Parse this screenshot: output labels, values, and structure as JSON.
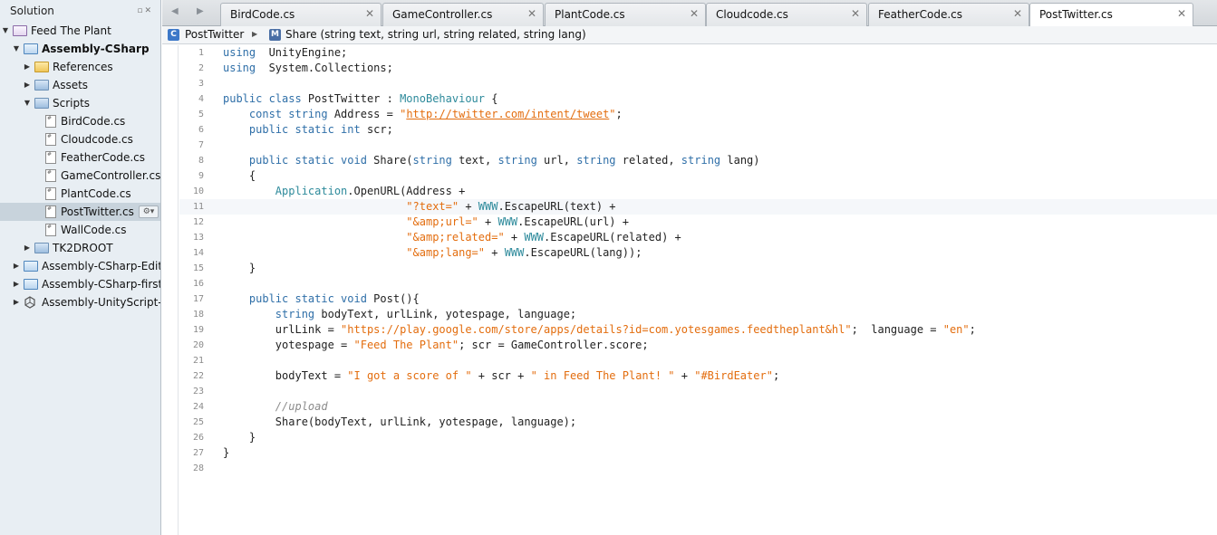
{
  "solution": {
    "title": "Solution",
    "header_buttons": "▫✕",
    "tree": [
      {
        "label": "Feed The Plant",
        "icon": "solution-icon",
        "depth": 0,
        "arrow": "▼",
        "bold": false
      },
      {
        "label": "Assembly-CSharp",
        "icon": "project-icon",
        "depth": 1,
        "arrow": "▼",
        "bold": true
      },
      {
        "label": "References",
        "icon": "folder-icon",
        "depth": 2,
        "arrow": "▶",
        "bold": false
      },
      {
        "label": "Assets",
        "icon": "folder-blue-icon",
        "depth": 2,
        "arrow": "▶",
        "bold": false
      },
      {
        "label": "Scripts",
        "icon": "folder-blue-icon",
        "depth": 2,
        "arrow": "▼",
        "bold": false
      },
      {
        "label": "BirdCode.cs",
        "icon": "file-icon",
        "depth": 3,
        "arrow": "",
        "bold": false
      },
      {
        "label": "Cloudcode.cs",
        "icon": "file-icon",
        "depth": 3,
        "arrow": "",
        "bold": false
      },
      {
        "label": "FeatherCode.cs",
        "icon": "file-icon",
        "depth": 3,
        "arrow": "",
        "bold": false
      },
      {
        "label": "GameController.cs",
        "icon": "file-icon",
        "depth": 3,
        "arrow": "",
        "bold": false
      },
      {
        "label": "PlantCode.cs",
        "icon": "file-icon",
        "depth": 3,
        "arrow": "",
        "bold": false
      },
      {
        "label": "PostTwitter.cs",
        "icon": "file-icon",
        "depth": 3,
        "arrow": "",
        "bold": false,
        "selected": true
      },
      {
        "label": "WallCode.cs",
        "icon": "file-icon",
        "depth": 3,
        "arrow": "",
        "bold": false
      },
      {
        "label": "TK2DROOT",
        "icon": "folder-blue-icon",
        "depth": 2,
        "arrow": "▶",
        "bold": false
      },
      {
        "label": "Assembly-CSharp-Edito",
        "icon": "project-icon",
        "depth": 1,
        "arrow": "▶",
        "bold": false
      },
      {
        "label": "Assembly-CSharp-firstp",
        "icon": "project-icon",
        "depth": 1,
        "arrow": "▶",
        "bold": false
      },
      {
        "label": "Assembly-UnityScript-fi",
        "icon": "unity-icon",
        "depth": 1,
        "arrow": "▶",
        "bold": false
      }
    ]
  },
  "tabs": [
    {
      "label": "BirdCode.cs",
      "active": false
    },
    {
      "label": "GameController.cs",
      "active": false
    },
    {
      "label": "PlantCode.cs",
      "active": false
    },
    {
      "label": "Cloudcode.cs",
      "active": false
    },
    {
      "label": "FeatherCode.cs",
      "active": false
    },
    {
      "label": "PostTwitter.cs",
      "active": true
    }
  ],
  "breadcrumb": {
    "class_badge": "C",
    "class_name": "PostTwitter",
    "separator": "▶",
    "method_badge": "M",
    "method_signature": "Share (string text, string url, string related, string lang)"
  },
  "editor": {
    "current_line": 11,
    "lines": [
      [
        [
          "kw",
          "using"
        ],
        [
          "",
          "  UnityEngine;"
        ]
      ],
      [
        [
          "kw",
          "using"
        ],
        [
          "",
          "  System.Collections;"
        ]
      ],
      [],
      [
        [
          "kw",
          "public class"
        ],
        [
          "",
          " PostTwitter : "
        ],
        [
          "ty",
          "MonoBehaviour"
        ],
        [
          "",
          " {"
        ]
      ],
      [
        [
          "",
          "    "
        ],
        [
          "kw",
          "const string"
        ],
        [
          "",
          " Address = "
        ],
        [
          "str",
          "\""
        ],
        [
          "url",
          "http://twitter.com/intent/tweet"
        ],
        [
          "str",
          "\""
        ],
        [
          "",
          ";"
        ]
      ],
      [
        [
          "",
          "    "
        ],
        [
          "kw",
          "public static int"
        ],
        [
          "",
          " scr;"
        ]
      ],
      [],
      [
        [
          "",
          "    "
        ],
        [
          "kw",
          "public static void"
        ],
        [
          "",
          " Share("
        ],
        [
          "kw",
          "string"
        ],
        [
          "",
          " text, "
        ],
        [
          "kw",
          "string"
        ],
        [
          "",
          " url, "
        ],
        [
          "kw",
          "string"
        ],
        [
          "",
          " related, "
        ],
        [
          "kw",
          "string"
        ],
        [
          "",
          " lang)"
        ]
      ],
      [
        [
          "",
          "    {"
        ]
      ],
      [
        [
          "",
          "        "
        ],
        [
          "ty",
          "Application"
        ],
        [
          "",
          ".OpenURL(Address +"
        ]
      ],
      [
        [
          "",
          "                            "
        ],
        [
          "str",
          "\"?text=\""
        ],
        [
          "",
          " + "
        ],
        [
          "ty",
          "WWW"
        ],
        [
          "",
          ".EscapeURL(text) +"
        ]
      ],
      [
        [
          "",
          "                            "
        ],
        [
          "str",
          "\"&amp;url=\""
        ],
        [
          "",
          " + "
        ],
        [
          "ty",
          "WWW"
        ],
        [
          "",
          ".EscapeURL(url) +"
        ]
      ],
      [
        [
          "",
          "                            "
        ],
        [
          "str",
          "\"&amp;related=\""
        ],
        [
          "",
          " + "
        ],
        [
          "ty",
          "WWW"
        ],
        [
          "",
          ".EscapeURL(related) +"
        ]
      ],
      [
        [
          "",
          "                            "
        ],
        [
          "str",
          "\"&amp;lang=\""
        ],
        [
          "",
          " + "
        ],
        [
          "ty",
          "WWW"
        ],
        [
          "",
          ".EscapeURL(lang));"
        ]
      ],
      [
        [
          "",
          "    }"
        ]
      ],
      [],
      [
        [
          "",
          "    "
        ],
        [
          "kw",
          "public static void"
        ],
        [
          "",
          " Post(){"
        ]
      ],
      [
        [
          "",
          "        "
        ],
        [
          "kw",
          "string"
        ],
        [
          "",
          " bodyText, urlLink, yotespage, language;"
        ]
      ],
      [
        [
          "",
          "        urlLink = "
        ],
        [
          "str",
          "\"https://play.google.com/store/apps/details?id=com.yotesgames.feedtheplant&hl\""
        ],
        [
          "",
          ";  language = "
        ],
        [
          "str",
          "\"en\""
        ],
        [
          "",
          ";"
        ]
      ],
      [
        [
          "",
          "        yotespage = "
        ],
        [
          "str",
          "\"Feed The Plant\""
        ],
        [
          "",
          "; scr = GameController.score;"
        ]
      ],
      [],
      [
        [
          "",
          "        bodyText = "
        ],
        [
          "str",
          "\"I got a score of \""
        ],
        [
          "",
          " + scr + "
        ],
        [
          "str",
          "\" in Feed The Plant! \""
        ],
        [
          "",
          " + "
        ],
        [
          "str",
          "\"#BirdEater\""
        ],
        [
          "",
          ";"
        ]
      ],
      [],
      [
        [
          "",
          "        "
        ],
        [
          "cm",
          "//upload"
        ]
      ],
      [
        [
          "",
          "        Share(bodyText, urlLink, yotespage, language);"
        ]
      ],
      [
        [
          "",
          "    }"
        ]
      ],
      [
        [
          "",
          "}"
        ]
      ],
      []
    ]
  }
}
